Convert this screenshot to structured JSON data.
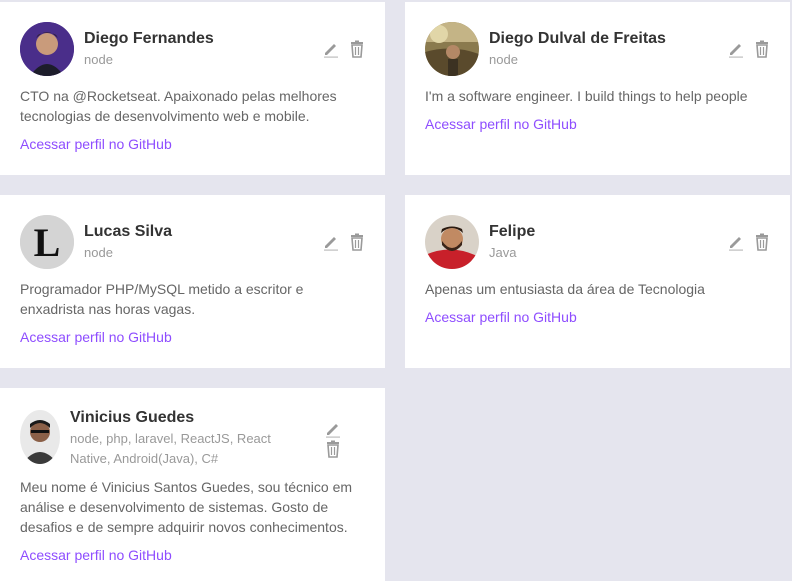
{
  "devs": [
    {
      "name": "Diego Fernandes",
      "techs": "node",
      "bio": "CTO na @Rocketseat. Apaixonado pelas melhores tecnologias de desenvolvimento web e mobile.",
      "link": "Acessar perfil no GitHub",
      "avatar_icon": "avatar-photo"
    },
    {
      "name": "Diego Dulval de Freitas",
      "techs": "node",
      "bio": "I'm a software engineer. I build things to help people",
      "link": "Acessar perfil no GitHub",
      "avatar_icon": "avatar-photo"
    },
    {
      "name": "Lucas Silva",
      "techs": "node",
      "bio": "Programador PHP/MySQL metido a escritor e enxadrista nas horas vagas.",
      "link": "Acessar perfil no GitHub",
      "avatar_icon": "avatar-letter-l"
    },
    {
      "name": "Felipe",
      "techs": "Java",
      "bio": "Apenas um entusiasta da área de Tecnologia",
      "link": "Acessar perfil no GitHub",
      "avatar_icon": "avatar-photo"
    },
    {
      "name": "Vinicius Guedes",
      "techs": "node, php, laravel, ReactJS, React Native, Android(Java), C#",
      "bio": "Meu nome é Vinicius Santos Guedes, sou técnico em análise e desenvolvimento de sistemas. Gosto de desafios e de sempre adquirir novos conhecimentos.",
      "link": "Acessar perfil no GitHub",
      "avatar_icon": "avatar-photo"
    }
  ],
  "icons": {
    "edit": "pencil-icon",
    "delete": "trash-icon"
  },
  "colors": {
    "background": "#e5e5ee",
    "card": "#ffffff",
    "link": "#8e4dff",
    "name": "#333333",
    "muted": "#999999"
  }
}
